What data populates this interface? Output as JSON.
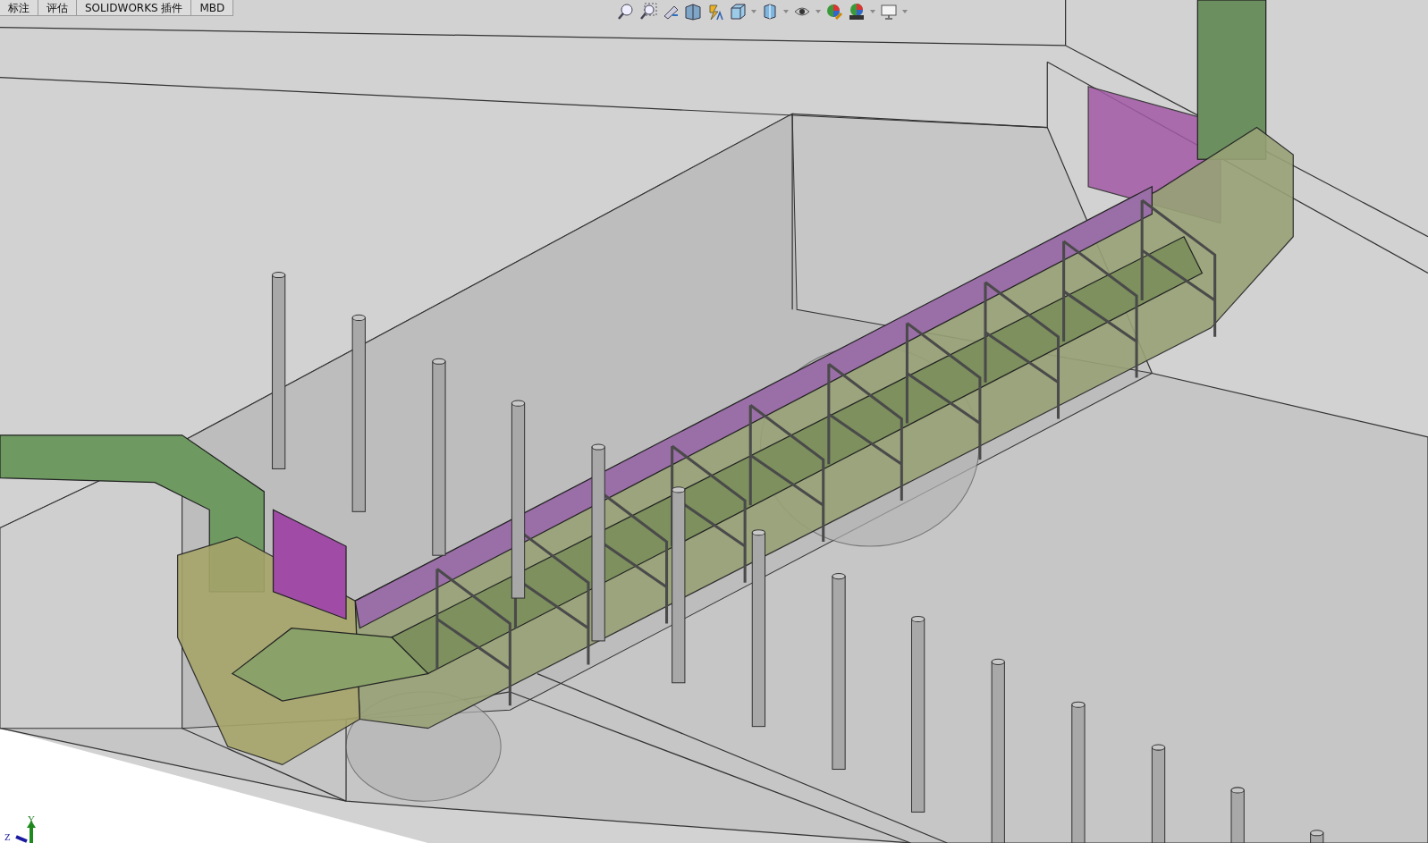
{
  "command_tabs": [
    {
      "label": "标注"
    },
    {
      "label": "评估"
    },
    {
      "label": "SOLIDWORKS 插件"
    },
    {
      "label": "MBD"
    }
  ],
  "triad": {
    "y_label": "Y",
    "z_label": "Z"
  }
}
